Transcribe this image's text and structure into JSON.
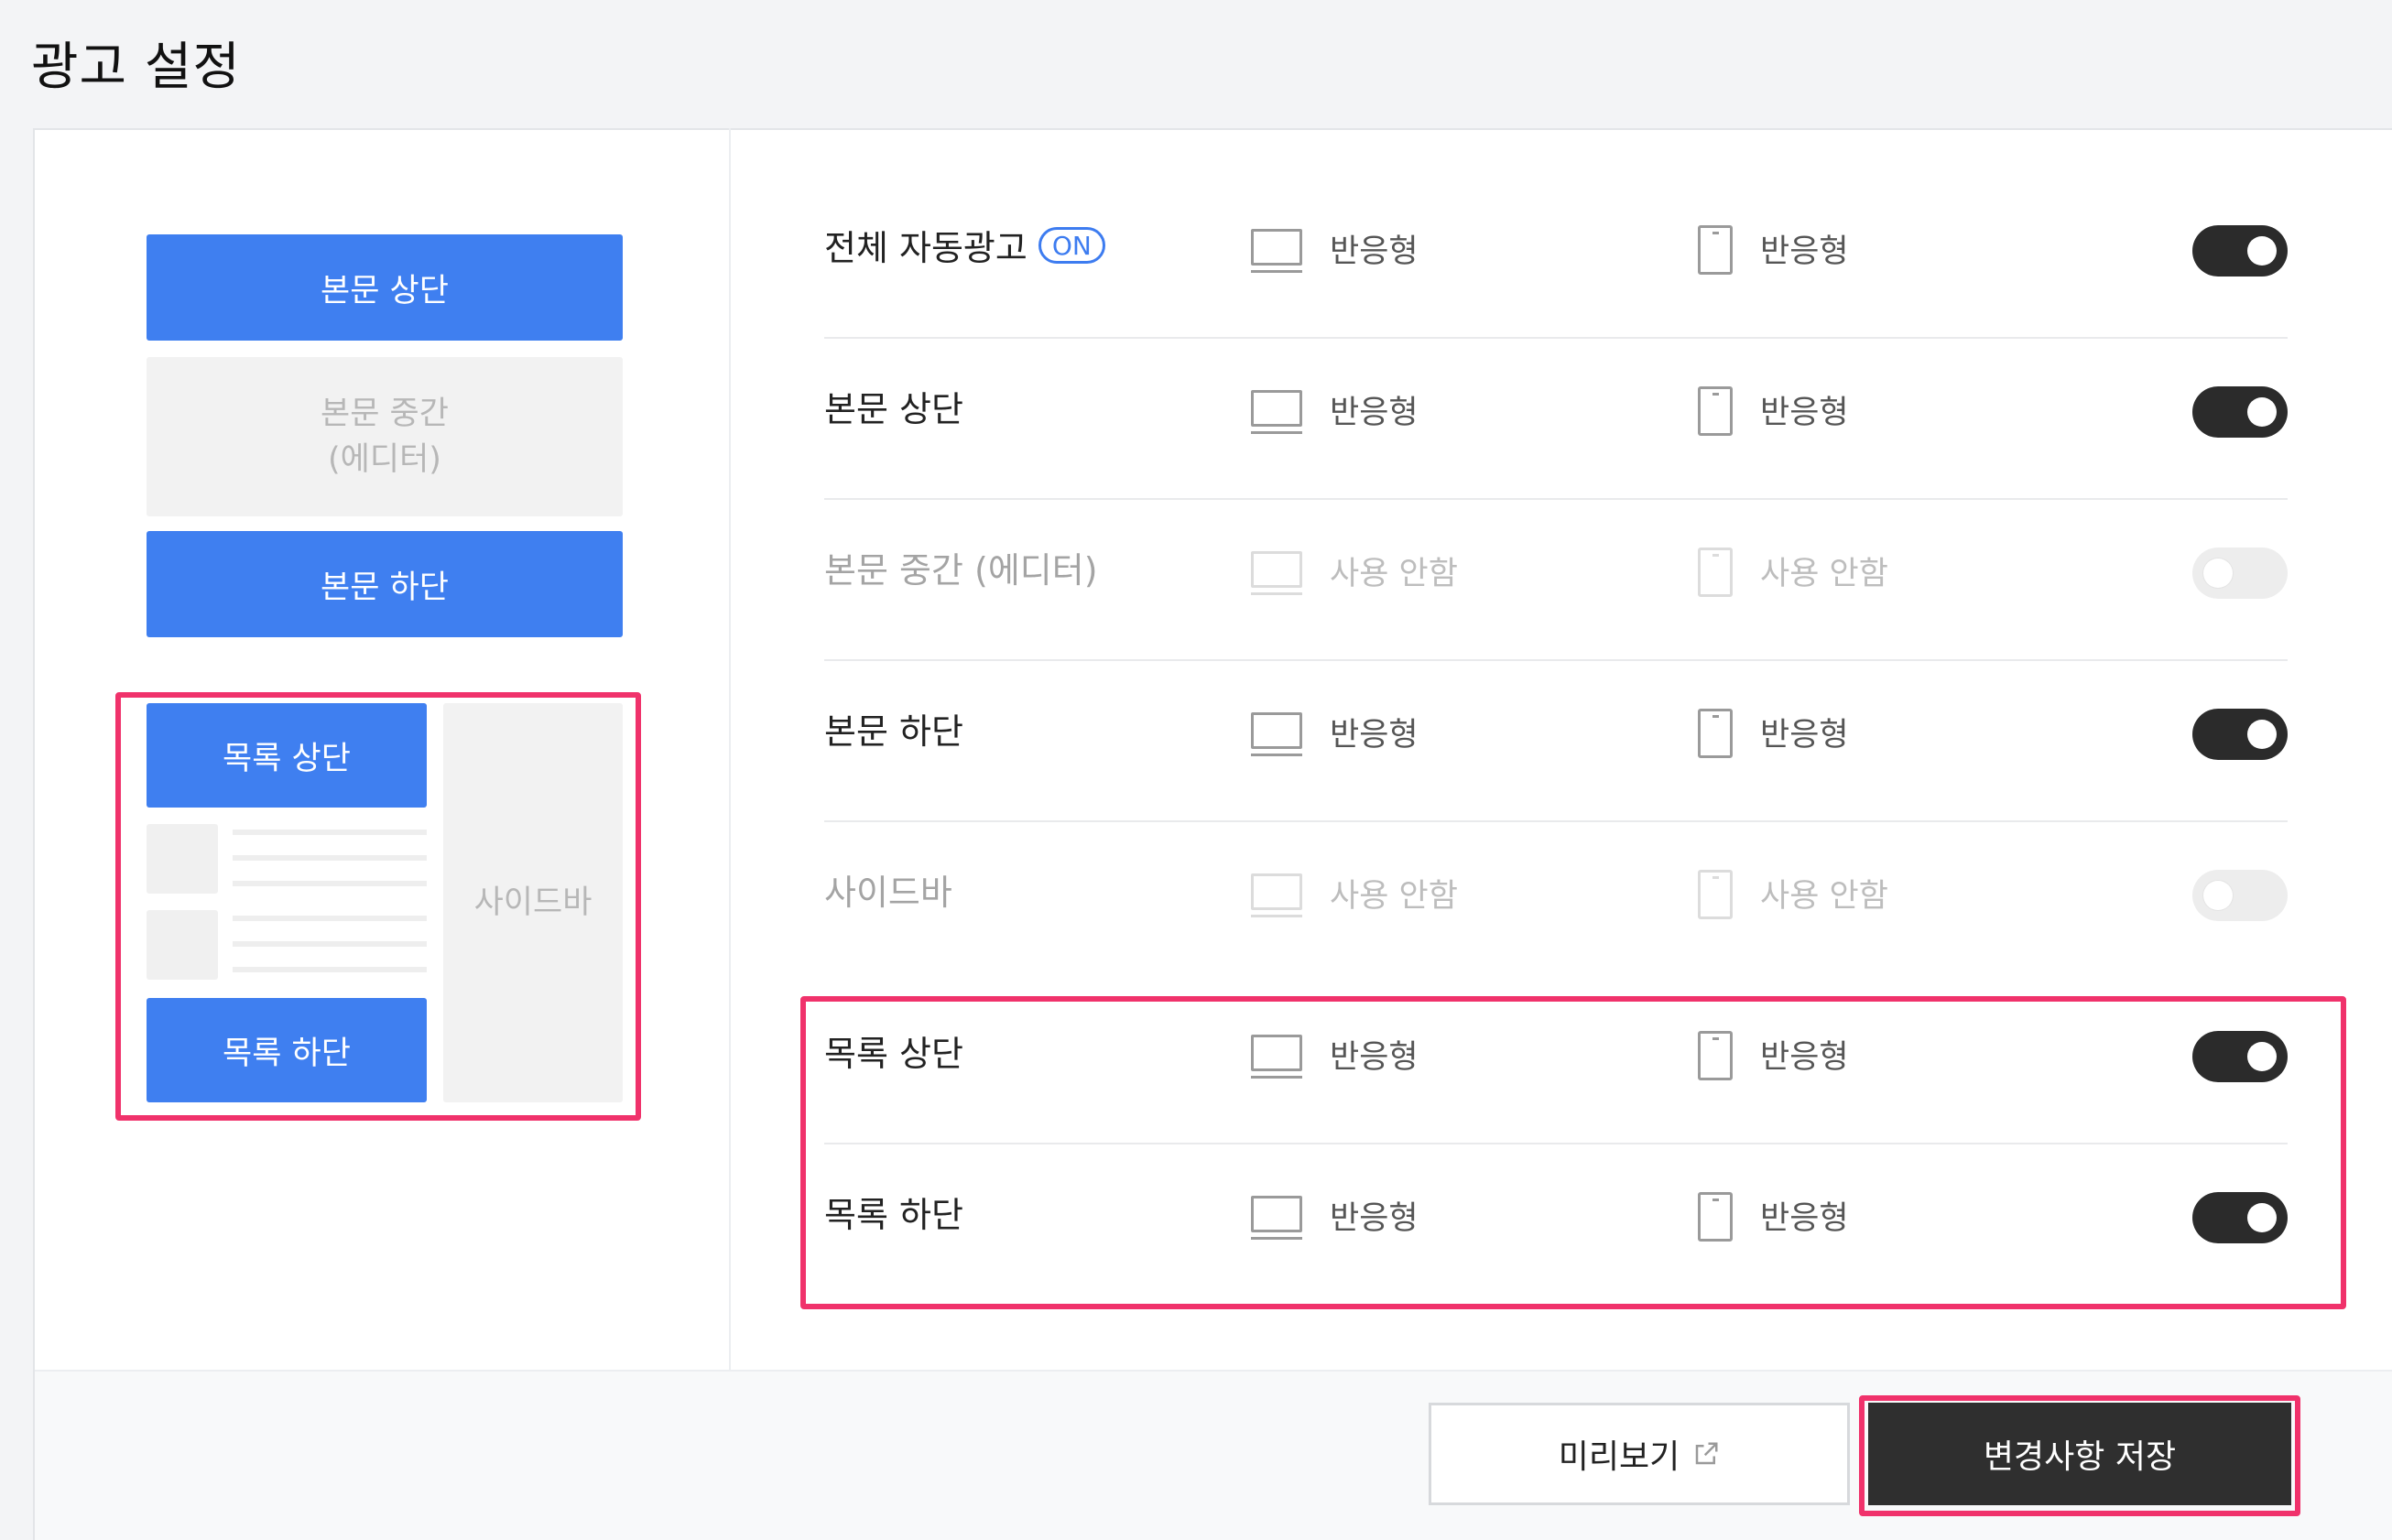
{
  "page": {
    "title": "광고 설정"
  },
  "preview": {
    "body_top": "본문 상단",
    "body_middle_line1": "본문 중간",
    "body_middle_line2": "(에디터)",
    "body_bottom": "본문 하단",
    "list_top": "목록 상단",
    "list_bottom": "목록 하단",
    "sidebar": "사이드바"
  },
  "rows": [
    {
      "name": "전체 자동광고",
      "badge": "ON",
      "pc": "반응형",
      "mobile": "반응형",
      "enabled": true
    },
    {
      "name": "본문 상단",
      "pc": "반응형",
      "mobile": "반응형",
      "enabled": true
    },
    {
      "name": "본문 중간 (에디터)",
      "pc": "사용 안함",
      "mobile": "사용 안함",
      "enabled": false
    },
    {
      "name": "본문 하단",
      "pc": "반응형",
      "mobile": "반응형",
      "enabled": true
    },
    {
      "name": "사이드바",
      "pc": "사용 안함",
      "mobile": "사용 안함",
      "enabled": false
    },
    {
      "name": "목록 상단",
      "pc": "반응형",
      "mobile": "반응형",
      "enabled": true
    },
    {
      "name": "목록 하단",
      "pc": "반응형",
      "mobile": "반응형",
      "enabled": true
    }
  ],
  "footer": {
    "preview_label": "미리보기",
    "save_label": "변경사항 저장"
  },
  "colors": {
    "accent_blue": "#3f7ff0",
    "highlight": "#f0326b",
    "toggle_on": "#2b2b2b",
    "save_button": "#2f2f2f"
  }
}
